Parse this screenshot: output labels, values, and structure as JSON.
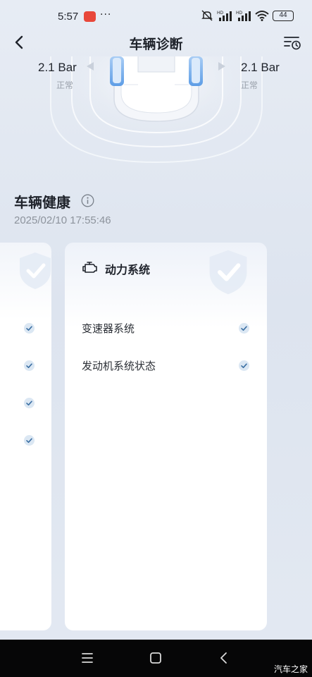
{
  "status": {
    "time": "5:57",
    "dots": "···",
    "battery": "44"
  },
  "header": {
    "title": "车辆诊断"
  },
  "tires": {
    "left": {
      "value": "2.1 Bar",
      "status": "正常"
    },
    "right": {
      "value": "2.1 Bar",
      "status": "正常"
    }
  },
  "health": {
    "title": "车辆健康",
    "timestamp": "2025/02/10 17:55:46"
  },
  "card": {
    "title": "动力系统",
    "items": [
      {
        "label": "变速器系统"
      },
      {
        "label": "发动机系统状态"
      }
    ]
  },
  "watermark": "汽车之家",
  "colors": {
    "accent": "#4a8fdc",
    "check_bg": "#dbe7f3"
  }
}
